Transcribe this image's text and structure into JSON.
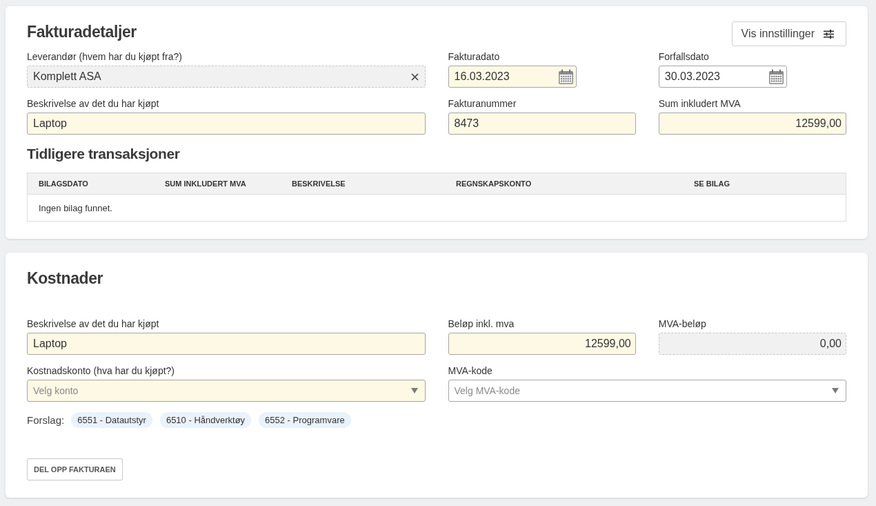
{
  "invoice_details": {
    "title": "Fakturadetaljer",
    "settings_button": {
      "label": "Vis innstillinger"
    },
    "rows": [
      [
        {
          "kind": "clearable",
          "label": "Leverandør (hvem har du kjøpt fra?)",
          "value": "Komplett ASA",
          "highlighted": false,
          "disabled": true
        },
        {
          "kind": "date",
          "label": "Fakturadato",
          "value": "16.03.2023",
          "highlighted": true,
          "disabled": false
        },
        {
          "kind": "date",
          "label": "Forfallsdato",
          "value": "30.03.2023",
          "highlighted": false,
          "disabled": false
        }
      ],
      [
        {
          "kind": "text",
          "label": "Beskrivelse av det du har kjøpt",
          "value": "Laptop",
          "highlighted": true,
          "disabled": false
        },
        {
          "kind": "text",
          "label": "Fakturanummer",
          "value": "8473",
          "highlighted": true,
          "disabled": false
        },
        {
          "kind": "amount",
          "label": "Sum inkludert MVA",
          "value": "12599,00",
          "highlighted": true,
          "disabled": false
        }
      ]
    ],
    "previous_transactions": {
      "title": "Tidligere transaksjoner",
      "columns": [
        "BILAGSDATO",
        "SUM INKLUDERT MVA",
        "BESKRIVELSE",
        "REGNSKAPSKONTO",
        "SE BILAG"
      ],
      "empty_message": "Ingen bilag funnet."
    }
  },
  "costs": {
    "title": "Kostnader",
    "rows": [
      [
        {
          "kind": "text",
          "label": "Beskrivelse av det du har kjøpt",
          "value": "Laptop",
          "highlighted": true,
          "disabled": false
        },
        {
          "kind": "amount",
          "label": "Beløp inkl. mva",
          "value": "12599,00",
          "highlighted": true,
          "disabled": false
        },
        {
          "kind": "amount",
          "label": "MVA-beløp",
          "value": "0,00",
          "highlighted": false,
          "disabled": true
        }
      ],
      [
        {
          "kind": "select",
          "label": "Kostnadskonto (hva har du kjøpt?)",
          "placeholder": "Velg konto",
          "highlighted": true,
          "disabled": false
        },
        {
          "kind": "select",
          "label": "MVA-kode",
          "placeholder": "Velg MVA-kode",
          "highlighted": false,
          "disabled": false
        }
      ]
    ],
    "suggestions": {
      "label": "Forslag:",
      "items": [
        "6551 - Datautstyr",
        "6510 - Håndverktøy",
        "6552 - Programvare"
      ]
    },
    "split_button": {
      "label": "DEL OPP FAKTURAEN"
    }
  }
}
